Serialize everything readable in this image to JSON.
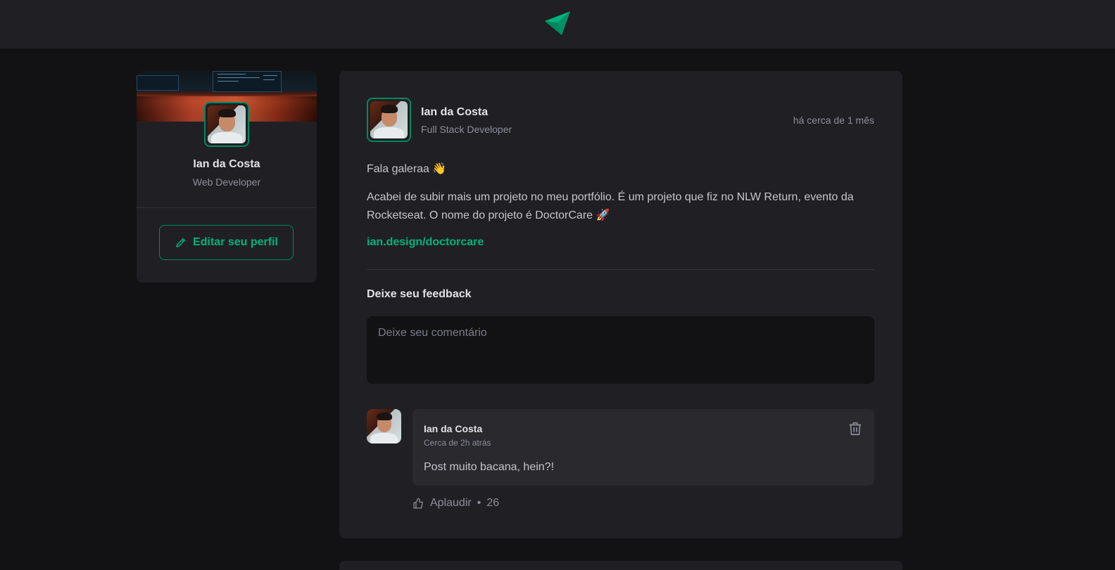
{
  "colors": {
    "accent": "#00b37e",
    "accent_dark": "#00875f",
    "bg": "#121214",
    "card": "#202024"
  },
  "sidebar": {
    "name": "Ian da Costa",
    "role": "Web Developer",
    "edit_label": "Editar seu perfil"
  },
  "post": {
    "author": "Ian da Costa",
    "role": "Full Stack Developer",
    "time": "há cerca de 1 mês",
    "paragraph1": "Fala galeraa 👋",
    "paragraph2": "Acabei de subir mais um projeto no meu portfólio. É um projeto que fiz no NLW Return, evento da Rocketseat. O nome do projeto é DoctorCare 🚀",
    "link": "ian.design/doctorcare",
    "feedback_title": "Deixe seu feedback",
    "feedback_placeholder": "Deixe seu comentário"
  },
  "comment": {
    "author": "Ian da Costa",
    "time": "Cerca de 2h atrás",
    "text": "Post muito bacana, hein?!",
    "applaud_label": "Aplaudir",
    "applaud_separator": "•",
    "applaud_count": "26"
  }
}
